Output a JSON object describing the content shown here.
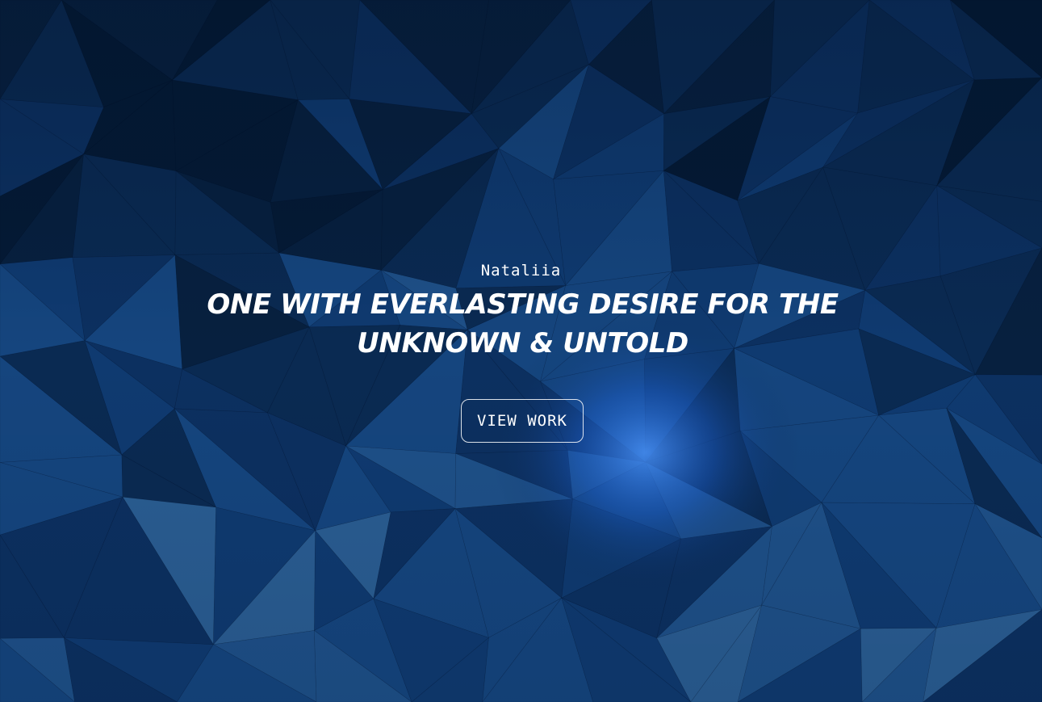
{
  "hero": {
    "name": "Nataliia",
    "headline": "ONE WITH EVERLASTING DESIRE FOR THE UNKNOWN & UNTOLD",
    "cta_label": "VIEW WORK"
  },
  "colors": {
    "background_dark": "#051a35",
    "background_mid": "#0b2a55",
    "background_light": "#3a6290",
    "glow": "#2f7bff",
    "text": "#ffffff"
  }
}
